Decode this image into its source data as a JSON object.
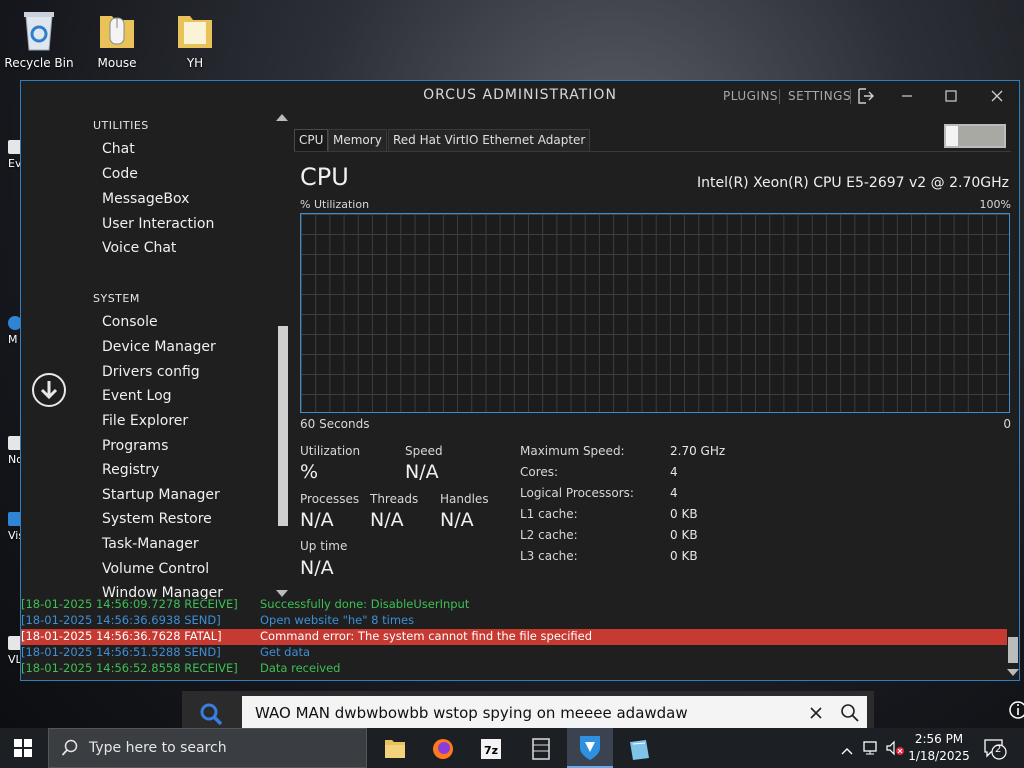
{
  "desktop": {
    "icons": [
      {
        "label": "Recycle Bin"
      },
      {
        "label": "Mouse"
      },
      {
        "label": "YH"
      }
    ],
    "partial_labels": [
      "Ev",
      "M",
      "No",
      "Vis",
      "VL"
    ]
  },
  "window": {
    "title": "ORCUS ADMINISTRATION",
    "plugins_label": "PLUGINS",
    "settings_label": "SETTINGS"
  },
  "sidebar": {
    "utilities_header": "UTILITIES",
    "utilities": [
      {
        "label": "Chat"
      },
      {
        "label": "Code"
      },
      {
        "label": "MessageBox"
      },
      {
        "label": "User Interaction"
      },
      {
        "label": "Voice Chat"
      }
    ],
    "system_header": "SYSTEM",
    "system": [
      {
        "label": "Console"
      },
      {
        "label": "Device Manager"
      },
      {
        "label": "Drivers config"
      },
      {
        "label": "Event Log"
      },
      {
        "label": "File Explorer"
      },
      {
        "label": "Programs"
      },
      {
        "label": "Registry"
      },
      {
        "label": "Startup Manager"
      },
      {
        "label": "System Restore"
      },
      {
        "label": "Task-Manager"
      },
      {
        "label": "Volume Control"
      },
      {
        "label": "Window Manager"
      }
    ]
  },
  "performance": {
    "tabs": [
      {
        "label": "CPU"
      },
      {
        "label": "Memory"
      },
      {
        "label": "Red Hat VirtIO Ethernet Adapter"
      }
    ],
    "heading": "CPU",
    "cpu_name": "Intel(R) Xeon(R) CPU E5-2697 v2 @ 2.70GHz",
    "graph_label": "% Utilization",
    "graph_max": "100%",
    "graph_span": "60 Seconds",
    "graph_min": "0",
    "utilization_label": "Utilization",
    "utilization_value": "%",
    "speed_label": "Speed",
    "speed_value": "N/A",
    "processes_label": "Processes",
    "processes_value": "N/A",
    "threads_label": "Threads",
    "threads_value": "N/A",
    "handles_label": "Handles",
    "handles_value": "N/A",
    "uptime_label": "Up time",
    "uptime_value": "N/A",
    "details": [
      {
        "label": "Maximum Speed:",
        "value": "2.70 GHz"
      },
      {
        "label": "Cores:",
        "value": "4"
      },
      {
        "label": "Logical Processors:",
        "value": "4"
      },
      {
        "label": "L1 cache:",
        "value": "0 KB"
      },
      {
        "label": "L2 cache:",
        "value": "0 KB"
      },
      {
        "label": "L3 cache:",
        "value": "0 KB"
      }
    ]
  },
  "log": [
    {
      "time": "[18-01-2025 14:56:09.7278 RECEIVE]",
      "message": "Successfully done: DisableUserInput",
      "level": "receive"
    },
    {
      "time": "[18-01-2025 14:56:36.6938 SEND]",
      "message": "Open website \"he\" 8 times",
      "level": "send"
    },
    {
      "time": "[18-01-2025 14:56:36.7628 FATAL]",
      "message": "Command error: The system cannot find the file specified",
      "level": "fatal"
    },
    {
      "time": "[18-01-2025 14:56:51.5288 SEND]",
      "message": "Get data",
      "level": "send"
    },
    {
      "time": "[18-01-2025 14:56:52.8558 RECEIVE]",
      "message": "Data received",
      "level": "receive"
    }
  ],
  "search_overlay": {
    "query": "WAO MAN dwbwbowbb wstop spying on meeee adawdaw"
  },
  "taskbar": {
    "search_placeholder": "Type here to search",
    "time": "2:56 PM",
    "date": "1/18/2025",
    "notification_count": "2"
  },
  "colors": {
    "accent": "#2d7fbf",
    "fatal": "#c73a32",
    "receive": "#3fbf55",
    "send": "#3d8fd6"
  }
}
